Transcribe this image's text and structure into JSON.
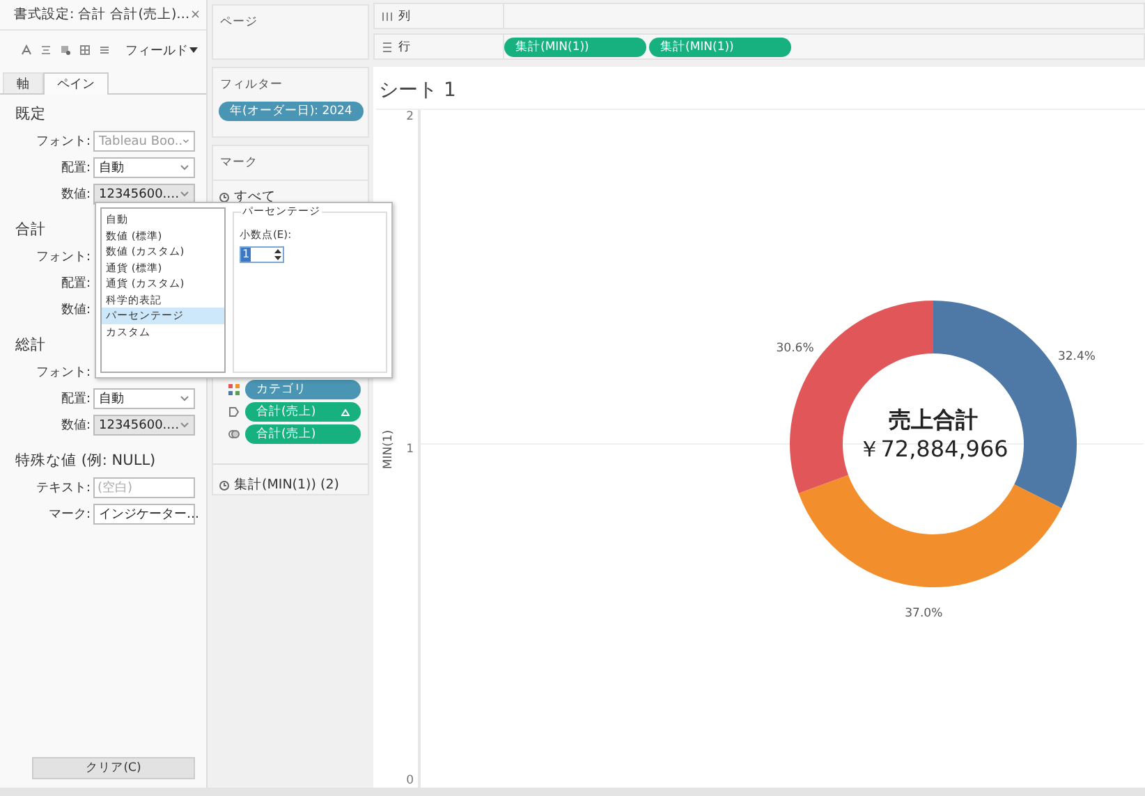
{
  "format_panel": {
    "title": "書式設定: 合計 合計(売上)…",
    "close": "×",
    "field_menu": "フィールド",
    "tabs": [
      {
        "label": "軸",
        "selected": false
      },
      {
        "label": "ペイン",
        "selected": true
      }
    ],
    "sections": [
      {
        "heading": "既定",
        "rows": [
          {
            "label": "フォント:",
            "kind": "dropdown",
            "value": "Tableau Boo..",
            "muted": true
          },
          {
            "label": "配置:",
            "kind": "dropdown",
            "value": "自動",
            "muted": false
          },
          {
            "label": "数値:",
            "kind": "readonly",
            "value": "12345600.…",
            "muted": false
          }
        ]
      },
      {
        "heading": "合計",
        "rows": [
          {
            "label": "フォント:",
            "kind": "hidden"
          },
          {
            "label": "配置:",
            "kind": "hidden"
          },
          {
            "label": "数値:",
            "kind": "hidden"
          }
        ]
      },
      {
        "heading": "総計",
        "rows": [
          {
            "label": "フォント:",
            "kind": "hidden"
          },
          {
            "label": "配置:",
            "kind": "dropdown",
            "value": "自動",
            "muted": false
          },
          {
            "label": "数値:",
            "kind": "readonly",
            "value": "12345600.…",
            "muted": false
          }
        ]
      },
      {
        "heading": "特殊な値 (例: NULL)",
        "rows": [
          {
            "label": "テキスト:",
            "kind": "text",
            "placeholder": "(空白)"
          },
          {
            "label": "マーク:",
            "kind": "dropdown",
            "value": "インジケーター…",
            "muted": false
          }
        ]
      }
    ],
    "clear_button": "クリア(C)"
  },
  "pages_shelf": {
    "title": "ページ"
  },
  "filters_shelf": {
    "title": "フィルター",
    "pills": [
      "年(オーダー日): 2024"
    ]
  },
  "marks_card": {
    "title": "マーク",
    "all": "すべて",
    "pills": [
      {
        "label": "カテゴリ",
        "kind": "color",
        "color": "#4a95b3"
      },
      {
        "label": "合計(売上)",
        "kind": "label",
        "color": "#17b07f",
        "delta": true
      },
      {
        "label": "合計(売上)",
        "kind": "detail",
        "color": "#17b07f",
        "delta": false
      }
    ],
    "second": "集計(MIN(1)) (2)"
  },
  "columns_shelf": {
    "label": "列"
  },
  "rows_shelf": {
    "label": "行",
    "pills": [
      "集計(MIN(1))",
      "集計(MIN(1))"
    ]
  },
  "sheet": {
    "title": "シート 1",
    "axis": {
      "label": "MIN(1)",
      "ticks": [
        "2",
        "1",
        "0"
      ]
    },
    "center_title": "売上合計",
    "center_value": "￥72,884,966",
    "chart_data": {
      "type": "donut",
      "values": [
        32.4,
        37.0,
        30.6
      ],
      "colors": [
        "#4e79a7",
        "#f28e2b",
        "#e15759"
      ],
      "value_labels": [
        "32.4%",
        "37.0%",
        "30.6%"
      ]
    }
  },
  "format_popup": {
    "options": [
      {
        "label": "自動",
        "selected": false
      },
      {
        "label": "数値 (標準)",
        "selected": false
      },
      {
        "label": "数値 (カスタム)",
        "selected": false
      },
      {
        "label": "通貨 (標準)",
        "selected": false
      },
      {
        "label": "通貨 (カスタム)",
        "selected": false
      },
      {
        "label": "科学的表記",
        "selected": false
      },
      {
        "label": "パーセンテージ",
        "selected": true
      },
      {
        "label": "カスタム",
        "selected": false
      }
    ],
    "group": "パーセンテージ",
    "decimals_label": "小数点(E):",
    "decimals_value": "1"
  }
}
